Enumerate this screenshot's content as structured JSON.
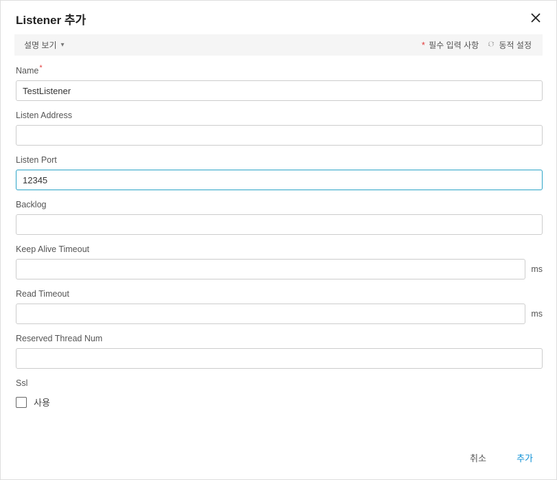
{
  "header": {
    "title": "Listener 추가"
  },
  "infobar": {
    "view_desc": "설명 보기",
    "required_label": "필수 입력 사항",
    "dynamic_label": "동적 설정"
  },
  "fields": {
    "name": {
      "label": "Name",
      "value": "TestListener",
      "required": true
    },
    "listen_address": {
      "label": "Listen Address",
      "value": ""
    },
    "listen_port": {
      "label": "Listen Port",
      "value": "12345"
    },
    "backlog": {
      "label": "Backlog",
      "value": ""
    },
    "keep_alive_timeout": {
      "label": "Keep Alive Timeout",
      "value": "",
      "unit": "ms"
    },
    "read_timeout": {
      "label": "Read Timeout",
      "value": "",
      "unit": "ms"
    },
    "reserved_thread_num": {
      "label": "Reserved Thread Num",
      "value": ""
    },
    "ssl": {
      "label": "Ssl",
      "checkbox_label": "사용",
      "checked": false
    }
  },
  "footer": {
    "cancel": "취소",
    "submit": "추가"
  }
}
